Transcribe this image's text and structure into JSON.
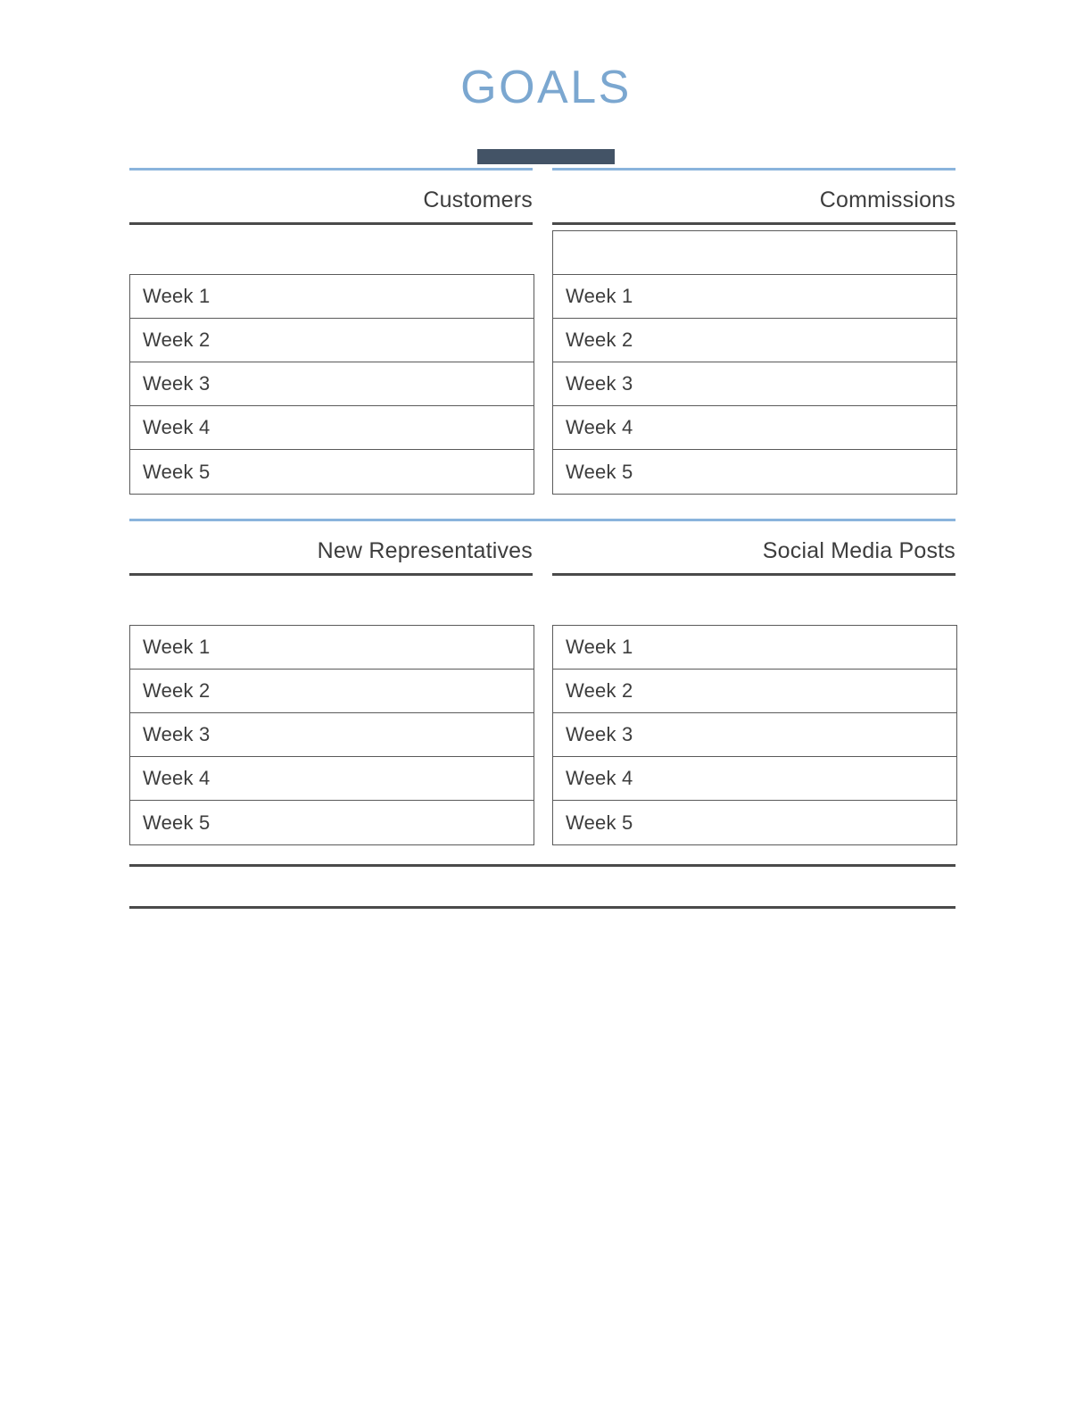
{
  "document": {
    "title": "GOALS",
    "accent_blue": "#8ab4dc",
    "title_color": "#7ba7d0",
    "title_bar_color": "#435366",
    "rule_color": "#4a4a4a",
    "table_border_color": "#5a5a5a"
  },
  "sections": [
    {
      "columns": [
        {
          "label": "Customers",
          "has_leading_empty_row": false,
          "rows": [
            "Week 1",
            "Week 2",
            "Week 3",
            "Week 4",
            "Week 5"
          ]
        },
        {
          "label": "Commissions",
          "has_leading_empty_row": true,
          "rows": [
            "Week 1",
            "Week 2",
            "Week 3",
            "Week 4",
            "Week 5"
          ]
        }
      ]
    },
    {
      "columns": [
        {
          "label": "New Representatives",
          "has_leading_empty_row": false,
          "rows": [
            "Week 1",
            "Week 2",
            "Week 3",
            "Week 4",
            "Week 5"
          ]
        },
        {
          "label": "Social Media Posts",
          "has_leading_empty_row": false,
          "rows": [
            "Week 1",
            "Week 2",
            "Week 3",
            "Week 4",
            "Week 5"
          ]
        }
      ]
    }
  ]
}
